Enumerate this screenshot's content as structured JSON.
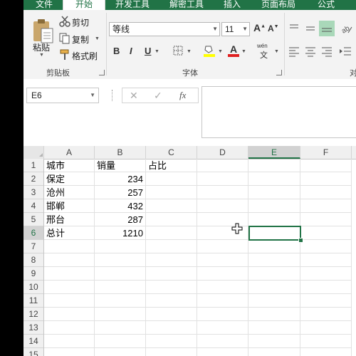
{
  "tabs": [
    {
      "label": "文件",
      "active": false
    },
    {
      "label": "开始",
      "active": true
    },
    {
      "label": "开发工具",
      "active": false
    },
    {
      "label": "解密工具",
      "active": false
    },
    {
      "label": "插入",
      "active": false
    },
    {
      "label": "页面布局",
      "active": false
    },
    {
      "label": "公式",
      "active": false
    }
  ],
  "ribbon": {
    "clipboard": {
      "paste": "粘贴",
      "cut": "剪切",
      "copy": "复制",
      "format_painter": "格式刷",
      "group": "剪贴板"
    },
    "font": {
      "name": "等线",
      "size": "11",
      "bold": "B",
      "italic": "I",
      "underline": "U",
      "grow": "A",
      "shrink": "A",
      "font_color": "A",
      "phonetic_top": "wén",
      "phonetic_bottom": "文",
      "group": "字体"
    },
    "align": {
      "group_partial": "对"
    }
  },
  "formula_bar": {
    "name_box": "E6",
    "cancel": "✕",
    "enter": "✓",
    "fx": "fx",
    "content": ""
  },
  "columns": [
    "A",
    "B",
    "C",
    "D",
    "E",
    "F"
  ],
  "rows": [
    "1",
    "2",
    "3",
    "4",
    "5",
    "6",
    "7",
    "8",
    "9",
    "10",
    "11",
    "12",
    "13",
    "14",
    "15"
  ],
  "sheet": {
    "A": [
      "城市",
      "保定",
      "沧州",
      "邯郸",
      "邢台",
      "总计"
    ],
    "B": [
      "销量",
      "234",
      "257",
      "432",
      "287",
      "1210"
    ],
    "C": [
      "占比",
      "",
      "",
      "",
      "",
      ""
    ]
  },
  "active_cell": "E6",
  "colors": {
    "brand": "#217346",
    "ribbon_bg": "#f3f3f3",
    "header_bg": "#f0f0f0",
    "paste_icon": "#c9a66b"
  }
}
